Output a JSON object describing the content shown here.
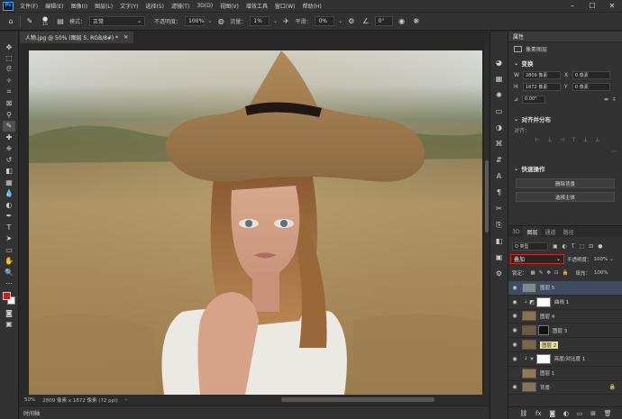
{
  "menubar": {
    "logo": "Ps",
    "items": [
      "文件(F)",
      "编辑(E)",
      "图像(I)",
      "图层(L)",
      "文字(Y)",
      "选择(S)",
      "滤镜(T)",
      "3D(D)",
      "视图(V)",
      "增效工具",
      "窗口(W)",
      "帮助(H)"
    ]
  },
  "options": {
    "mode_label": "模式：",
    "mode_value": "正常",
    "opacity_label": "不透明度：",
    "opacity_value": "100%",
    "flow_label": "流量：",
    "flow_value": "1%",
    "smoothing_label": "平滑：",
    "smoothing_value": "0%",
    "angle_value": "0°",
    "brush_size": "15"
  },
  "document": {
    "tab_title": "人物.jpg @ 50% (图层 5, RGB/8#) *"
  },
  "status": {
    "zoom": "50%",
    "doc_size": "2809 像素 x 1872 像素 (72 ppi)"
  },
  "timeline": {
    "label": "时间轴"
  },
  "properties": {
    "title": "属性",
    "pixel_layer": "像素图层",
    "transform_title": "变换",
    "w_label": "W",
    "w_value": "2809 像素",
    "h_label": "H",
    "h_value": "1872 像素",
    "x_label": "X",
    "x_value": "0 像素",
    "y_label": "Y",
    "y_value": "0 像素",
    "angle": "0.00°",
    "align_title": "对齐并分布",
    "align_sub": "对齐：",
    "quick_title": "快速操作",
    "btn_remove_bg": "删除背景",
    "btn_select_subject": "选择主体"
  },
  "layers_panel": {
    "tabs": [
      "3D",
      "图层",
      "通道",
      "路径"
    ],
    "filter_label": "Q 类型",
    "blend_mode": "叠加",
    "opacity_label": "不透明度：",
    "opacity_value": "100%",
    "lock_label": "锁定：",
    "fill_label": "填充：",
    "fill_value": "100%",
    "layers": [
      {
        "name": "图层 5",
        "thumb": "#7d8a96"
      },
      {
        "name": "曲线 1",
        "thumb": "#ffffff"
      },
      {
        "name": "图层 4",
        "thumb": "#8a7350"
      },
      {
        "name": "图层 3",
        "thumb": "#6e5a3e"
      },
      {
        "name": "图层 2",
        "thumb": "#7a6748"
      },
      {
        "name": "亮度/对比度 1",
        "thumb": "#ffffff"
      },
      {
        "name": "图层 1",
        "thumb": "#8f7a55"
      },
      {
        "name": "背景",
        "thumb": "#8a7552"
      }
    ]
  }
}
